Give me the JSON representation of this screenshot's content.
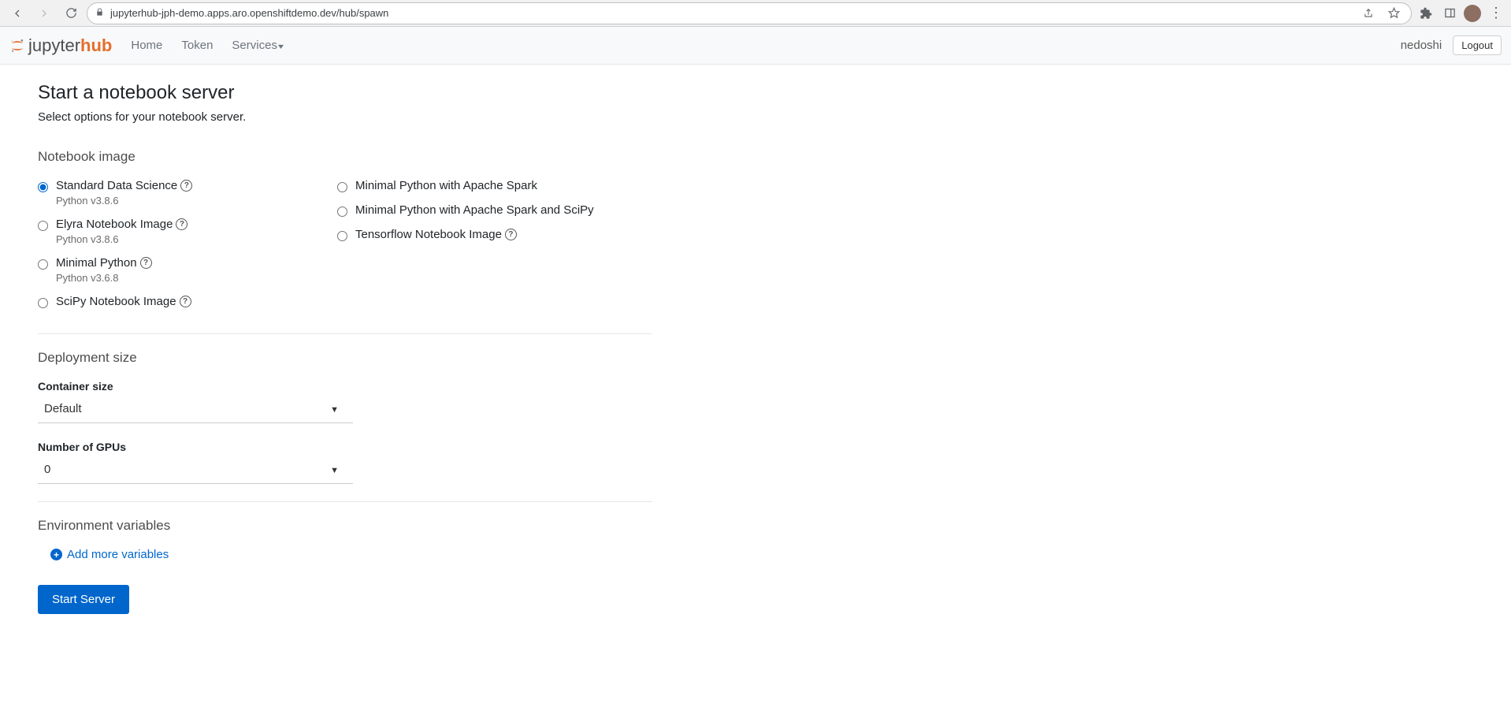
{
  "browser": {
    "url": "jupyterhub-jph-demo.apps.aro.openshiftdemo.dev/hub/spawn"
  },
  "nav": {
    "brand_part1": "jupyter",
    "brand_part2": "hub",
    "links": {
      "home": "Home",
      "token": "Token",
      "services": "Services"
    },
    "username": "nedoshi",
    "logout": "Logout"
  },
  "page": {
    "title": "Start a notebook server",
    "subtitle": "Select options for your notebook server."
  },
  "images": {
    "heading": "Notebook image",
    "col1": [
      {
        "label": "Standard Data Science",
        "sub": "Python v3.8.6",
        "help": true,
        "checked": true
      },
      {
        "label": "Elyra Notebook Image",
        "sub": "Python v3.8.6",
        "help": true,
        "checked": false
      },
      {
        "label": "Minimal Python",
        "sub": "Python v3.6.8",
        "help": true,
        "checked": false
      },
      {
        "label": "SciPy Notebook Image",
        "sub": "",
        "help": true,
        "checked": false
      }
    ],
    "col2": [
      {
        "label": "Minimal Python with Apache Spark",
        "sub": "",
        "help": false,
        "checked": false
      },
      {
        "label": "Minimal Python with Apache Spark and SciPy",
        "sub": "",
        "help": false,
        "checked": false
      },
      {
        "label": "Tensorflow Notebook Image",
        "sub": "",
        "help": true,
        "checked": false
      }
    ]
  },
  "deployment": {
    "heading": "Deployment size",
    "container_label": "Container size",
    "container_value": "Default",
    "gpu_label": "Number of GPUs",
    "gpu_value": "0"
  },
  "env": {
    "heading": "Environment variables",
    "add_label": "Add more variables"
  },
  "actions": {
    "start": "Start Server"
  }
}
